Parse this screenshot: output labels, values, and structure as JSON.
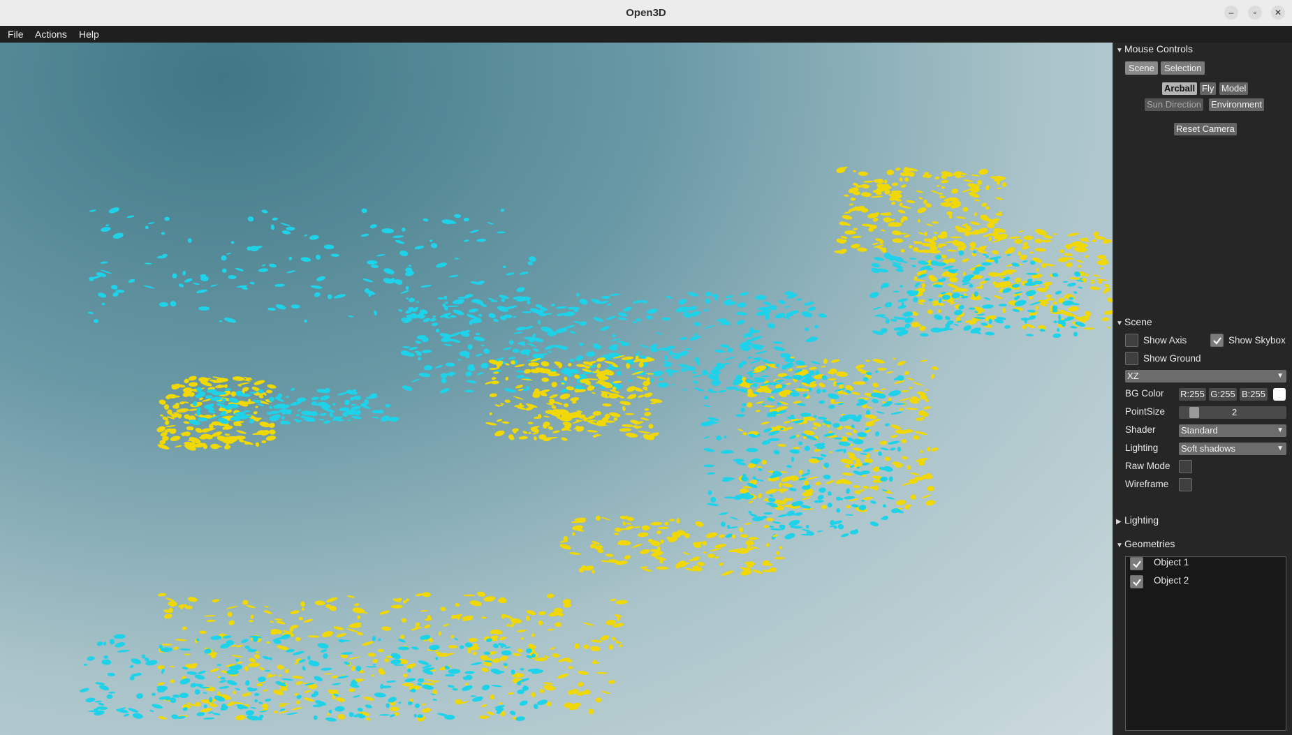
{
  "window": {
    "title": "Open3D",
    "controls": {
      "minimize": "–",
      "maximize": "▫",
      "close": "✕"
    }
  },
  "menu": {
    "items": [
      "File",
      "Actions",
      "Help"
    ]
  },
  "viewport": {
    "colors": {
      "object_1": "#f0d800",
      "object_2": "#1ed2ea"
    }
  },
  "panel": {
    "mouse_controls": {
      "header": "Mouse Controls",
      "tabs": [
        "Scene",
        "Selection"
      ],
      "buttons": [
        "Arcball",
        "Fly",
        "Model"
      ],
      "buttons_row2": [
        "Sun Direction",
        "Environment"
      ],
      "reset": "Reset Camera"
    },
    "scene": {
      "header": "Scene",
      "show_axis": {
        "label": "Show Axis",
        "checked": false
      },
      "show_skybox": {
        "label": "Show Skybox",
        "checked": true
      },
      "show_ground": {
        "label": "Show Ground",
        "checked": false
      },
      "ground_plane": "XZ",
      "bg_color": {
        "label": "BG Color",
        "r": "R:255",
        "g": "G:255",
        "b": "B:255",
        "swatch": "#ffffff"
      },
      "point_size": {
        "label": "PointSize",
        "value": "2"
      },
      "shader": {
        "label": "Shader",
        "value": "Standard"
      },
      "lighting": {
        "label": "Lighting",
        "value": "Soft shadows"
      },
      "raw_mode": {
        "label": "Raw Mode",
        "checked": false
      },
      "wireframe": {
        "label": "Wireframe",
        "checked": false
      }
    },
    "lighting_section": {
      "header": "Lighting",
      "expanded": false
    },
    "geometries": {
      "header": "Geometries",
      "items": [
        {
          "label": "Object 1",
          "checked": true
        },
        {
          "label": "Object 2",
          "checked": true
        }
      ]
    }
  }
}
